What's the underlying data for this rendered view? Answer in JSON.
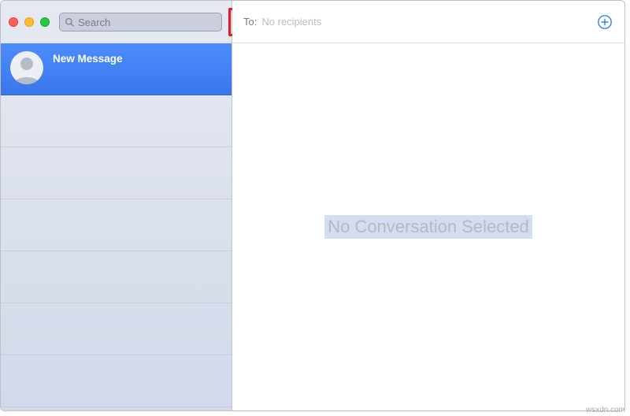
{
  "sidebar": {
    "search_placeholder": "Search",
    "conversations": [
      {
        "title": "New Message",
        "selected": true
      }
    ]
  },
  "main": {
    "to_label": "To:",
    "to_placeholder": "No recipients",
    "empty_state": "No Conversation Selected"
  },
  "watermark": "wsxdn.com",
  "colors": {
    "selection": "#3b7bf0",
    "highlight_box": "#e21c1c",
    "add_icon": "#1f86ff"
  }
}
